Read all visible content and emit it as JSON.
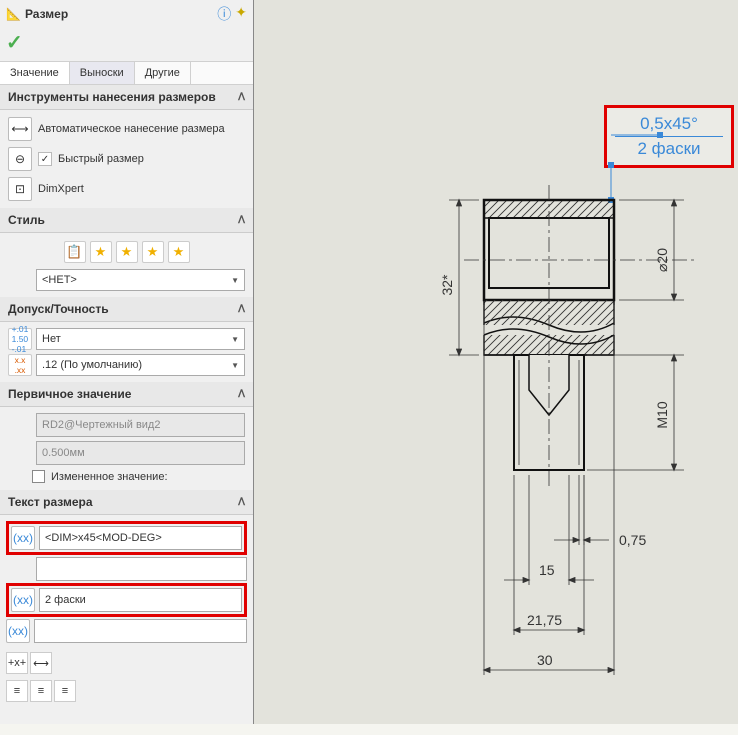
{
  "header": {
    "title": "Размер"
  },
  "tabs": {
    "value": "Значение",
    "leaders": "Выноски",
    "other": "Другие"
  },
  "tools_section": {
    "title": "Инструменты нанесения размеров",
    "auto": "Автоматическое нанесение размера",
    "quick": "Быстрый размер",
    "dimx": "DimXpert"
  },
  "style_section": {
    "title": "Стиль",
    "value": "<НЕТ>"
  },
  "tolerance_section": {
    "title": "Допуск/Точность",
    "t1": "Нет",
    "t2": ".12 (По умолчанию)"
  },
  "primary_section": {
    "title": "Первичное значение",
    "name": "RD2@Чертежный вид2",
    "value": "0.500мм",
    "changed_label": "Измененное значение:"
  },
  "text_section": {
    "title": "Текст размера",
    "field1": "<DIM>x45<MOD-DEG>",
    "field2": "2 фаски"
  },
  "callout": {
    "line1": "0,5x45°",
    "line2": "2 фаски"
  },
  "dims": {
    "d20": "⌀20",
    "d32": "32*",
    "m10": "M10",
    "d075": "0,75",
    "d15": "15",
    "d2175": "21,75",
    "d30": "30"
  }
}
